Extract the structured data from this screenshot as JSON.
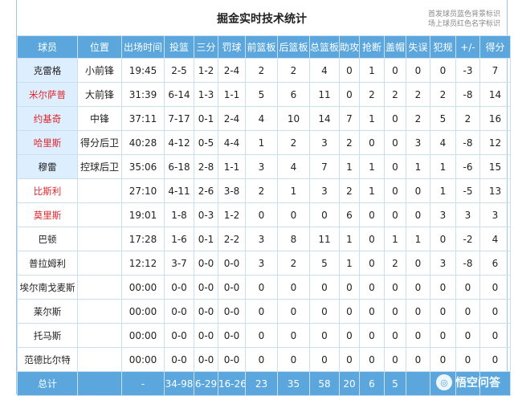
{
  "header": {
    "title": "掘金实时技术统计",
    "legend_line1": "首发球员蓝色背景标识",
    "legend_line2": "场上球员红色名字标识"
  },
  "columns": [
    "球员",
    "位置",
    "出场时间",
    "投篮",
    "三分",
    "罚球",
    "前篮板",
    "后篮板",
    "总篮板",
    "助攻",
    "抢断",
    "盖帽",
    "失误",
    "犯规",
    "+/-",
    "得分"
  ],
  "rows": [
    {
      "cells": [
        "克雷格",
        "小前锋",
        "19:45",
        "2-5",
        "1-2",
        "2-4",
        "2",
        "2",
        "4",
        "0",
        "1",
        "0",
        "0",
        "0",
        "-3",
        "7"
      ],
      "starter": true,
      "on_court": false
    },
    {
      "cells": [
        "米尔萨普",
        "大前锋",
        "31:39",
        "6-14",
        "1-3",
        "1-1",
        "5",
        "6",
        "11",
        "0",
        "2",
        "2",
        "2",
        "2",
        "-8",
        "14"
      ],
      "starter": true,
      "on_court": true
    },
    {
      "cells": [
        "约基奇",
        "中锋",
        "37:11",
        "7-17",
        "0-1",
        "2-4",
        "4",
        "10",
        "14",
        "7",
        "1",
        "0",
        "2",
        "5",
        "2",
        "16"
      ],
      "starter": true,
      "on_court": true
    },
    {
      "cells": [
        "哈里斯",
        "得分后卫",
        "40:28",
        "4-12",
        "0-5",
        "4-4",
        "1",
        "2",
        "3",
        "2",
        "0",
        "0",
        "3",
        "4",
        "-8",
        "12"
      ],
      "starter": true,
      "on_court": true
    },
    {
      "cells": [
        "穆雷",
        "控球后卫",
        "35:06",
        "6-18",
        "2-8",
        "1-1",
        "3",
        "4",
        "7",
        "1",
        "1",
        "0",
        "1",
        "1",
        "-6",
        "15"
      ],
      "starter": true,
      "on_court": false
    },
    {
      "cells": [
        "比斯利",
        "",
        "27:10",
        "4-11",
        "2-6",
        "3-8",
        "2",
        "1",
        "3",
        "2",
        "1",
        "0",
        "0",
        "1",
        "-5",
        "13"
      ],
      "starter": false,
      "on_court": true
    },
    {
      "cells": [
        "莫里斯",
        "",
        "19:01",
        "1-8",
        "0-3",
        "1-2",
        "0",
        "0",
        "0",
        "6",
        "0",
        "0",
        "0",
        "3",
        "3",
        "3"
      ],
      "starter": false,
      "on_court": true
    },
    {
      "cells": [
        "巴顿",
        "",
        "17:28",
        "1-6",
        "0-1",
        "2-2",
        "3",
        "8",
        "11",
        "1",
        "0",
        "1",
        "1",
        "0",
        "-2",
        "4"
      ],
      "starter": false,
      "on_court": false
    },
    {
      "cells": [
        "普拉姆利",
        "",
        "12:12",
        "3-7",
        "0-0",
        "0-0",
        "3",
        "2",
        "5",
        "1",
        "0",
        "2",
        "0",
        "3",
        "-8",
        "6"
      ],
      "starter": false,
      "on_court": false
    },
    {
      "cells": [
        "埃尔南戈麦斯",
        "",
        "00:00",
        "0-0",
        "0-0",
        "0-0",
        "0",
        "0",
        "0",
        "0",
        "0",
        "0",
        "0",
        "0",
        "0",
        "0"
      ],
      "starter": false,
      "on_court": false
    },
    {
      "cells": [
        "莱尔斯",
        "",
        "00:00",
        "0-0",
        "0-0",
        "0-0",
        "0",
        "0",
        "0",
        "0",
        "0",
        "0",
        "0",
        "0",
        "0",
        "0"
      ],
      "starter": false,
      "on_court": false
    },
    {
      "cells": [
        "托马斯",
        "",
        "00:00",
        "0-0",
        "0-0",
        "0-0",
        "0",
        "0",
        "0",
        "0",
        "0",
        "0",
        "0",
        "0",
        "0",
        "0"
      ],
      "starter": false,
      "on_court": false
    },
    {
      "cells": [
        "范德比尔特",
        "",
        "00:00",
        "0-0",
        "0-0",
        "0-0",
        "0",
        "0",
        "0",
        "0",
        "0",
        "0",
        "0",
        "0",
        "0",
        "0"
      ],
      "starter": false,
      "on_court": false
    }
  ],
  "totals": [
    "总计",
    "",
    "-",
    "34-98",
    "6-29",
    "16-26",
    "23",
    "35",
    "58",
    "20",
    "6",
    "5",
    "",
    "",
    "",
    ""
  ],
  "watermark": {
    "text": "悟空问答",
    "icon": "wukong-logo-icon"
  },
  "colors": {
    "header_bg": "#5aa6dd",
    "starter_bg": "#ddeeff",
    "on_court_text": "#e0262c"
  }
}
